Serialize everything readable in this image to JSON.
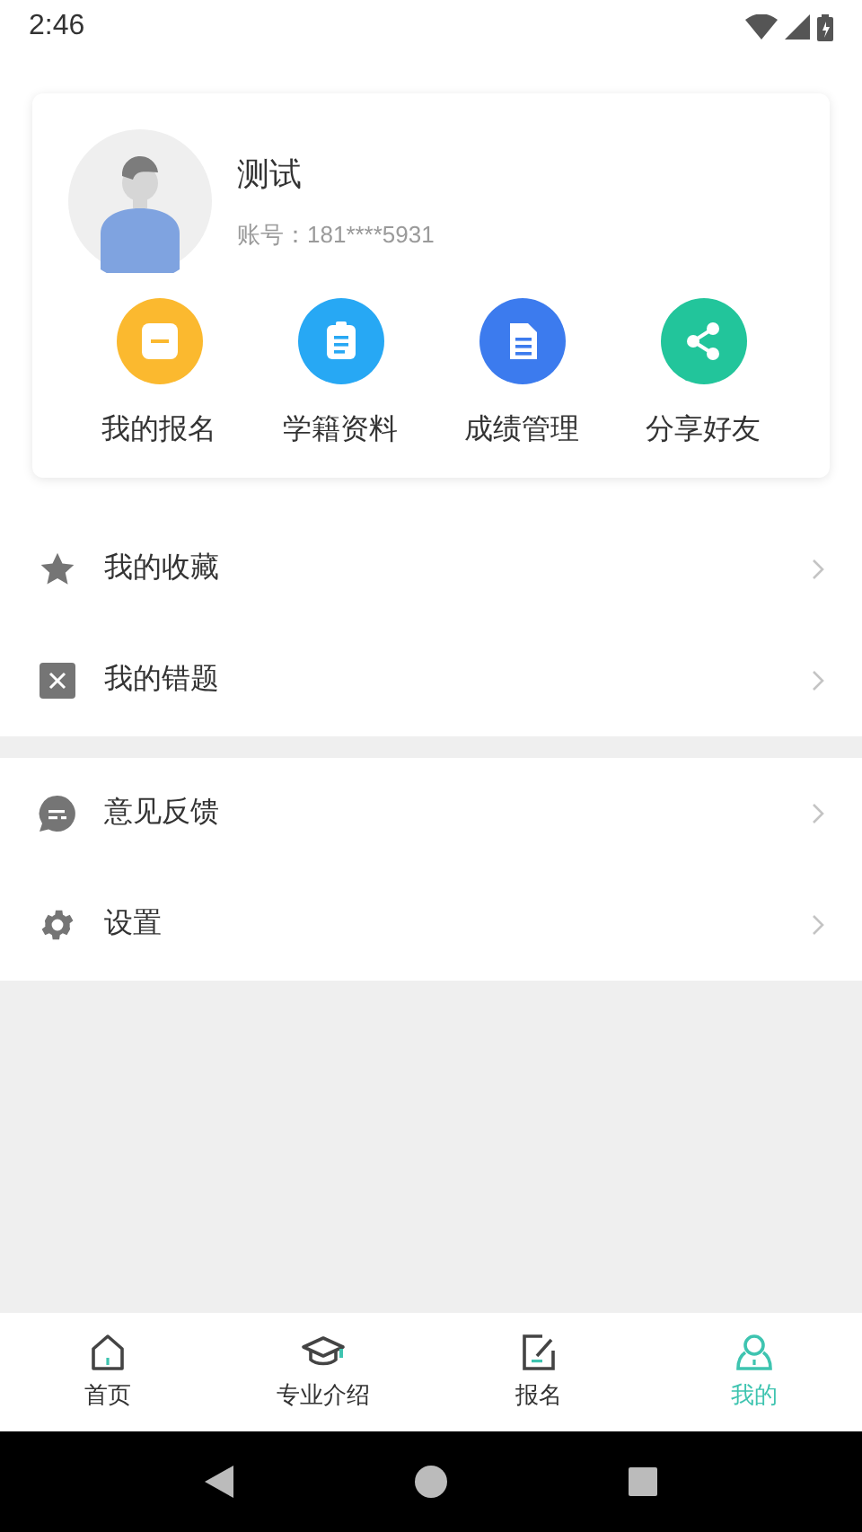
{
  "status_bar": {
    "time": "2:46"
  },
  "profile": {
    "name": "测试",
    "account": "账号：181****5931"
  },
  "shortcuts": [
    {
      "label": "我的报名",
      "kind": "signup",
      "color": "#fbb92f"
    },
    {
      "label": "学籍资料",
      "kind": "records",
      "color": "#27a8f4"
    },
    {
      "label": "成绩管理",
      "kind": "grades",
      "color": "#3c7bee"
    },
    {
      "label": "分享好友",
      "kind": "share",
      "color": "#22c59b"
    }
  ],
  "menu_groups": [
    [
      {
        "label": "我的收藏",
        "kind": "favorites"
      },
      {
        "label": "我的错题",
        "kind": "mistakes"
      }
    ],
    [
      {
        "label": "意见反馈",
        "kind": "feedback"
      },
      {
        "label": "设置",
        "kind": "settings"
      }
    ]
  ],
  "tabs": [
    {
      "label": "首页",
      "kind": "home",
      "selected": false
    },
    {
      "label": "专业介绍",
      "kind": "major",
      "selected": false
    },
    {
      "label": "报名",
      "kind": "signup",
      "selected": false
    },
    {
      "label": "我的",
      "kind": "me",
      "selected": true
    }
  ]
}
